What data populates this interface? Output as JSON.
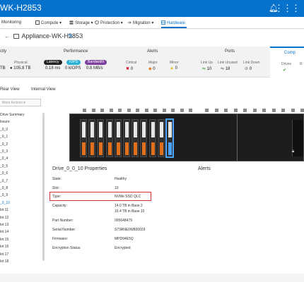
{
  "topbar": {
    "title": "WK-H2853",
    "bell_icon": "bell-icon",
    "menu_icon": "grid-icon"
  },
  "nav": {
    "items": [
      {
        "label": "Monitoring",
        "icon": ""
      },
      {
        "label": "Compute ▾",
        "icon": "compute-icon"
      },
      {
        "label": "Storage ▾",
        "icon": "storage-icon"
      },
      {
        "label": "Protection ▾",
        "icon": "shield-icon"
      },
      {
        "label": "Migration ▾",
        "icon": "migration-icon"
      },
      {
        "label": "Hardware",
        "icon": "hardware-icon"
      }
    ],
    "active": "Hardware"
  },
  "page": {
    "title": "Appliance-WK-H2853",
    "edit_icon": "pencil-icon"
  },
  "summary": {
    "capacity": {
      "title": "city",
      "physical_label": "Physical",
      "left_value": "TB",
      "physical_value": "105.8 TB"
    },
    "performance": {
      "title": "Performance",
      "latency": {
        "label": "Latency",
        "value": "0.18 ms",
        "color": "#222222"
      },
      "iops": {
        "label": "IOPS",
        "value": "0 kIOPS",
        "color": "#2bb3d6"
      },
      "bandwidth": {
        "label": "Bandwidth",
        "value": "0.8 MB/s",
        "color": "#7b3f9e"
      }
    },
    "alerts": {
      "title": "Alerts",
      "critical": {
        "label": "Critical",
        "value": "0"
      },
      "major": {
        "label": "Major",
        "value": "0"
      },
      "minor": {
        "label": "Minor",
        "value": "0"
      }
    },
    "ports": {
      "title": "Ports",
      "linkup": {
        "label": "Link Up",
        "value": "10"
      },
      "linkunused": {
        "label": "Link Unused",
        "value": "18"
      },
      "linkdown": {
        "label": "Link Down",
        "value": "0"
      }
    },
    "components": {
      "title": "Comp",
      "drives_label": "Drives",
      "r_label": "R"
    }
  },
  "viewtabs": {
    "rear": "Rear View",
    "internal": "Internal View"
  },
  "actions": {
    "more": "More Actions ▾"
  },
  "tree": {
    "items": [
      "Drive Summary",
      "losure",
      "_0_0",
      "_0_1",
      "_0_2",
      "_0_3",
      "_0_4",
      "_0_5",
      "_0_6",
      "_0_7",
      "_0_8",
      "_0_9",
      "_0_10",
      "lot 11",
      "lot 12",
      "lot 13",
      "lot 14",
      "lot 15",
      "lot 16",
      "lot 17",
      "lot 18"
    ],
    "selected_index": 12
  },
  "properties": {
    "title": "Drive_0_0_10 Properties",
    "rows": [
      {
        "label": "State:",
        "value": "Healthy"
      },
      {
        "label": "Slot:",
        "value": "10"
      },
      {
        "label": "Type:",
        "value": "NVMe SSD QLC"
      },
      {
        "label": "Capacity:",
        "value": "14.0 TB in Base 2",
        "value2": "15.4 TB in Base 10"
      },
      {
        "label": "Part Number:",
        "value": "005648479"
      },
      {
        "label": "Serial Number:",
        "value": "S73ANE0W800029"
      },
      {
        "label": "Firmware:",
        "value": "MPD94E5Q"
      },
      {
        "label": "Encryption Status:",
        "value": "Encrypted"
      }
    ]
  },
  "alerts_panel": {
    "title": "Alerts"
  }
}
